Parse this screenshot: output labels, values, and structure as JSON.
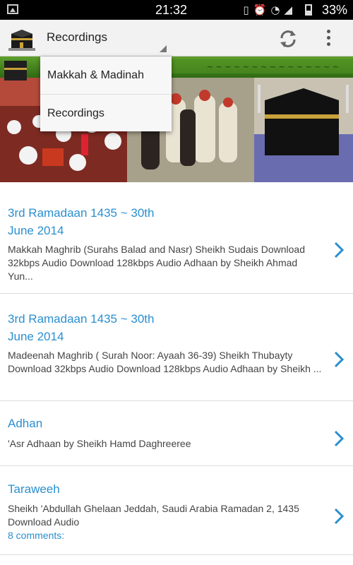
{
  "status_bar": {
    "time": "21:32",
    "battery": "33%",
    "icons": [
      "image-notification-icon",
      "vibrate-icon",
      "alarm-icon",
      "wifi-icon",
      "signal-icon",
      "battery-icon"
    ]
  },
  "action_bar": {
    "title": "Recordings",
    "icons": [
      "kaaba-app-icon",
      "refresh-icon",
      "overflow-menu-icon"
    ]
  },
  "dropdown": {
    "items": [
      {
        "label": "Makkah & Madinah"
      },
      {
        "label": "Recordings"
      }
    ]
  },
  "banner": {
    "description_icon": "mosque-banner-image"
  },
  "list": {
    "items": [
      {
        "title_line1": "3rd Ramadaan 1435 ~ 30th",
        "title_line2": "June 2014",
        "body": "Makkah Maghrib (Surahs Balad and Nasr) Sheikh Sudais Download 32kbps Audio Download 128kbps Audio Adhaan by Sheikh Ahmad Yun..."
      },
      {
        "title_line1": "3rd Ramadaan 1435 ~ 30th",
        "title_line2": "June 2014",
        "body": "Madeenah Maghrib ( Surah Noor: Ayaah 36-39) Sheikh Thubayty Download 32kbps Audio Download 128kbps Audio Adhaan by Sheikh ..."
      },
      {
        "title_line1": "Adhan",
        "body": "'Asr Adhaan by Sheikh Hamd Daghreeree"
      },
      {
        "title_line1": "Taraweeh",
        "body": "Sheikh 'Abdullah Ghelaan Jeddah, Saudi Arabia Ramadan 2, 1435 Download Audio",
        "comments": "8 comments:"
      }
    ]
  },
  "colors": {
    "accent": "#2a8fcf",
    "action_bar_bg": "#f2f2f2",
    "status_bar_bg": "#000000"
  }
}
